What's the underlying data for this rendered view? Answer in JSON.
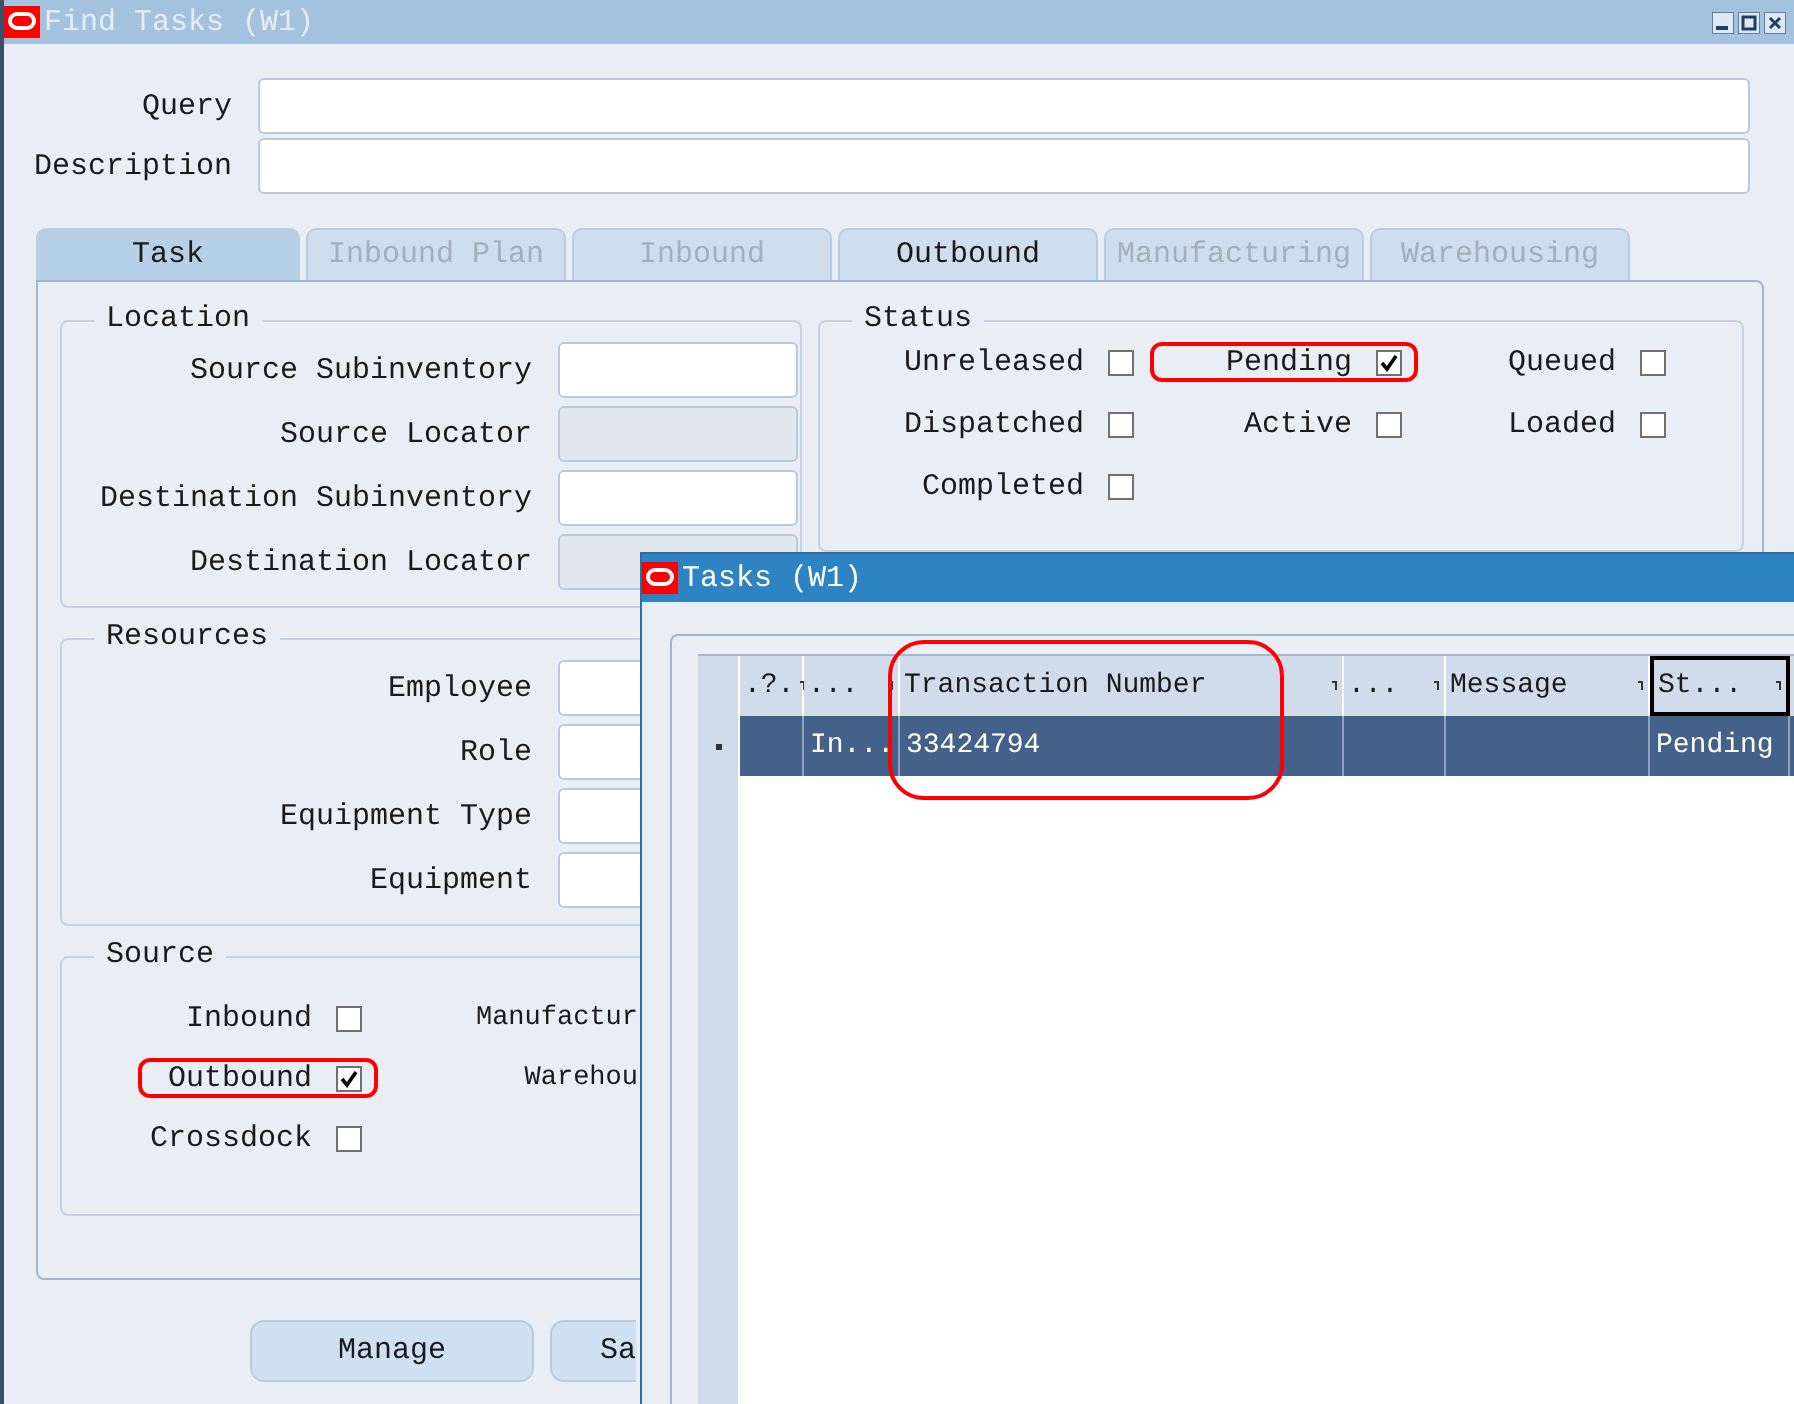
{
  "window": {
    "title": "Find Tasks (W1)"
  },
  "query": {
    "label": "Query"
  },
  "description": {
    "label": "Description"
  },
  "tabs": [
    {
      "label": "Task",
      "selected": true,
      "disabled": false
    },
    {
      "label": "Inbound Plan",
      "selected": false,
      "disabled": true
    },
    {
      "label": "Inbound",
      "selected": false,
      "disabled": true
    },
    {
      "label": "Outbound",
      "selected": false,
      "disabled": false
    },
    {
      "label": "Manufacturing",
      "selected": false,
      "disabled": true
    },
    {
      "label": "Warehousing",
      "selected": false,
      "disabled": true
    }
  ],
  "location": {
    "title": "Location",
    "fields": [
      {
        "label": "Source Subinventory",
        "disabled": false
      },
      {
        "label": "Source Locator",
        "disabled": true
      },
      {
        "label": "Destination Subinventory",
        "disabled": false
      },
      {
        "label": "Destination Locator",
        "disabled": true
      }
    ]
  },
  "status": {
    "title": "Status",
    "options": [
      {
        "label": "Unreleased",
        "checked": false,
        "highlighted": false
      },
      {
        "label": "Pending",
        "checked": true,
        "highlighted": true
      },
      {
        "label": "Queued",
        "checked": false,
        "highlighted": false
      },
      {
        "label": "Dispatched",
        "checked": false,
        "highlighted": false
      },
      {
        "label": "Active",
        "checked": false,
        "highlighted": false
      },
      {
        "label": "Loaded",
        "checked": false,
        "highlighted": false
      },
      {
        "label": "Completed",
        "checked": false,
        "highlighted": false
      }
    ]
  },
  "resources": {
    "title": "Resources",
    "fields": [
      {
        "label": "Employee",
        "disabled": false
      },
      {
        "label": "Role",
        "disabled": false
      },
      {
        "label": "Equipment Type",
        "disabled": false
      },
      {
        "label": "Equipment",
        "disabled": false
      }
    ]
  },
  "source": {
    "title": "Source",
    "options": [
      {
        "label": "Inbound",
        "checked": false,
        "highlighted": false
      },
      {
        "label": "Outbound",
        "checked": true,
        "highlighted": true
      },
      {
        "label": "Crossdock",
        "checked": false,
        "highlighted": false
      }
    ],
    "covered_labels": [
      "Manufactur",
      "Warehou"
    ]
  },
  "buttons": [
    {
      "label": "Manage"
    },
    {
      "label": "Sa"
    }
  ],
  "tasks_window": {
    "title": "Tasks (W1)",
    "columns": [
      {
        "label": ".?.",
        "focused": false,
        "highlighted": false
      },
      {
        "label": "...",
        "focused": false,
        "highlighted": false
      },
      {
        "label": "Transaction Number",
        "focused": false,
        "highlighted": true
      },
      {
        "label": "...",
        "focused": false,
        "highlighted": false
      },
      {
        "label": "Message",
        "focused": false,
        "highlighted": false
      },
      {
        "label": "St...",
        "focused": true,
        "highlighted": false
      }
    ],
    "rows": [
      {
        "selected": true,
        "cells": [
          "",
          "In...",
          "33424794",
          "",
          "",
          "Pending"
        ]
      }
    ]
  }
}
